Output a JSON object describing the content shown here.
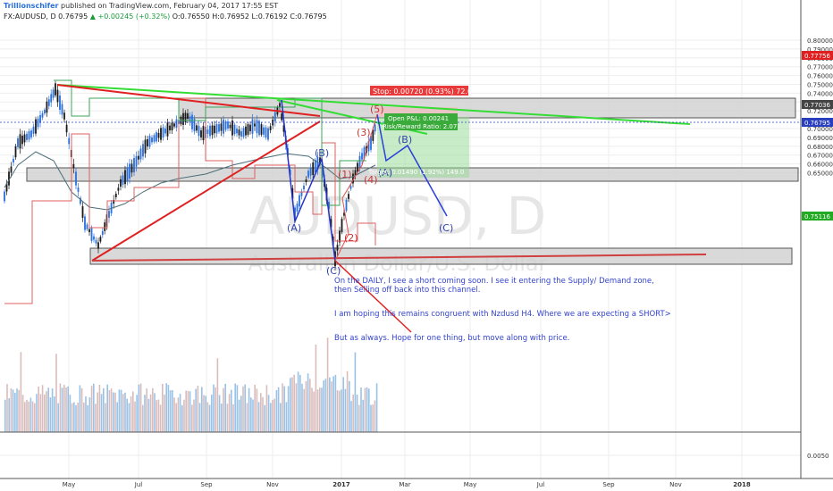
{
  "header": {
    "author": "Trillionschifer",
    "published": "published on TradingView.com, February 04, 2017 17:55 EST",
    "symbol": "FX:AUDUSD, D",
    "last": "0.76795",
    "arrow": "▲",
    "change": "+0.00245 (+0.32%)",
    "ohlc": "O:0.76550 H:0.76952 L:0.76192 C:0.76795"
  },
  "chart_data": {
    "type": "candlestick",
    "symbol": "AUDUSD",
    "timeframe": "D",
    "watermark": {
      "symbol": "AUDUSD, D",
      "name": "Australian Dollar/U.S. Dollar"
    },
    "y_ticks": [
      "0.80000",
      "0.79000",
      "0.78000",
      "0.77000",
      "0.76000",
      "0.75000",
      "0.74000",
      "0.73000",
      "0.72000",
      "0.71000",
      "0.70000",
      "0.69000",
      "0.68000",
      "0.67000",
      "0.66000",
      "0.65000",
      "0.0050"
    ],
    "x_ticks": [
      "May",
      "Jul",
      "Sep",
      "Nov",
      "2017",
      "Mar",
      "May",
      "Jul",
      "Sep",
      "Nov",
      "2018"
    ],
    "price_markers": [
      {
        "label": "0.77756",
        "color": "#e02020"
      },
      {
        "label": "0.77036",
        "color": "#444444"
      },
      {
        "label": "0.76795",
        "color": "#2a3fbf"
      },
      {
        "label": "0.75116",
        "color": "#22aa22"
      }
    ],
    "last_price": 0.76795,
    "ohlc": {
      "open": 0.7655,
      "high": 0.76952,
      "low": 0.76192,
      "close": 0.76795
    },
    "position": {
      "stop_text": "Stop: 0.00720 (0.93%) 72.0",
      "open_pl_text": "Open P&L: 0.00241",
      "risk_reward_text": "Risk/Reward Ratio: 2.07",
      "target_text": "Target: 0.01490 (1.92%) 149.0"
    },
    "wave_labels": [
      "(A)",
      "(B)",
      "(C)",
      "(1)",
      "(2)",
      "(3)",
      "(4)",
      "(5)",
      "(A)",
      "(B)",
      "(C)"
    ],
    "annotations": [
      "On the DAILY, I see a short coming soon. I see it entering the Supply/ Demand zone,",
      "then Selling off back into this channel.",
      "I am hoping this remains congruent with Nzdusd H4. Where we are expecting a SHORT>",
      "But as always. Hope for one thing, but move along with price."
    ],
    "colors": {
      "up": "#2a6fdb",
      "down": "#1a1a1a",
      "trend_green": "#33dd33",
      "trend_red": "#e02020",
      "wave_blue": "#2233cc"
    }
  }
}
